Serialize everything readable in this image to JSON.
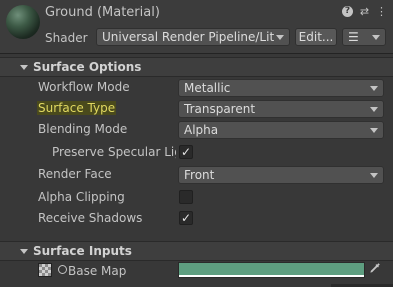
{
  "header": {
    "title": "Ground (Material)",
    "shader_label": "Shader",
    "shader_value": "Universal Render Pipeline/Lit",
    "edit_button": "Edit...",
    "list_button": "☰",
    "help_icon": "?",
    "settings_icon": "⇄",
    "more_icon": "⋮"
  },
  "surface_options": {
    "title": "Surface Options",
    "workflow_mode": {
      "label": "Workflow Mode",
      "value": "Metallic"
    },
    "surface_type": {
      "label": "Surface Type",
      "value": "Transparent"
    },
    "blending_mode": {
      "label": "Blending Mode",
      "value": "Alpha"
    },
    "preserve_specular": {
      "label": "Preserve Specular Lighting",
      "checked": true
    },
    "render_face": {
      "label": "Render Face",
      "value": "Front"
    },
    "alpha_clipping": {
      "label": "Alpha Clipping",
      "checked": false
    },
    "receive_shadows": {
      "label": "Receive Shadows",
      "checked": true
    }
  },
  "surface_inputs": {
    "title": "Surface Inputs",
    "base_map": {
      "label": "Base Map",
      "color": "#5e9e80"
    }
  },
  "check_glyph": "✓",
  "colors": {
    "highlight_text": "#e0d860",
    "base_map_color": "#5e9e80"
  }
}
